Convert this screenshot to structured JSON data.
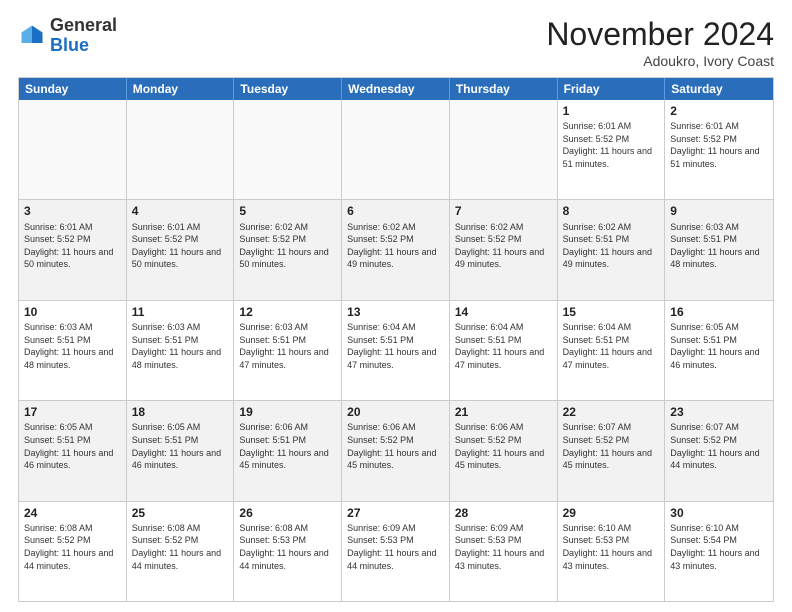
{
  "logo": {
    "line1": "General",
    "line2": "Blue"
  },
  "title": "November 2024",
  "location": "Adoukro, Ivory Coast",
  "header": {
    "days": [
      "Sunday",
      "Monday",
      "Tuesday",
      "Wednesday",
      "Thursday",
      "Friday",
      "Saturday"
    ]
  },
  "weeks": [
    {
      "cells": [
        {
          "day": "",
          "empty": true
        },
        {
          "day": "",
          "empty": true
        },
        {
          "day": "",
          "empty": true
        },
        {
          "day": "",
          "empty": true
        },
        {
          "day": "",
          "empty": true
        },
        {
          "day": "1",
          "sunrise": "6:01 AM",
          "sunset": "5:52 PM",
          "daylight": "11 hours and 51 minutes."
        },
        {
          "day": "2",
          "sunrise": "6:01 AM",
          "sunset": "5:52 PM",
          "daylight": "11 hours and 51 minutes."
        }
      ]
    },
    {
      "cells": [
        {
          "day": "3",
          "sunrise": "6:01 AM",
          "sunset": "5:52 PM",
          "daylight": "11 hours and 50 minutes."
        },
        {
          "day": "4",
          "sunrise": "6:01 AM",
          "sunset": "5:52 PM",
          "daylight": "11 hours and 50 minutes."
        },
        {
          "day": "5",
          "sunrise": "6:02 AM",
          "sunset": "5:52 PM",
          "daylight": "11 hours and 50 minutes."
        },
        {
          "day": "6",
          "sunrise": "6:02 AM",
          "sunset": "5:52 PM",
          "daylight": "11 hours and 49 minutes."
        },
        {
          "day": "7",
          "sunrise": "6:02 AM",
          "sunset": "5:52 PM",
          "daylight": "11 hours and 49 minutes."
        },
        {
          "day": "8",
          "sunrise": "6:02 AM",
          "sunset": "5:51 PM",
          "daylight": "11 hours and 49 minutes."
        },
        {
          "day": "9",
          "sunrise": "6:03 AM",
          "sunset": "5:51 PM",
          "daylight": "11 hours and 48 minutes."
        }
      ]
    },
    {
      "cells": [
        {
          "day": "10",
          "sunrise": "6:03 AM",
          "sunset": "5:51 PM",
          "daylight": "11 hours and 48 minutes."
        },
        {
          "day": "11",
          "sunrise": "6:03 AM",
          "sunset": "5:51 PM",
          "daylight": "11 hours and 48 minutes."
        },
        {
          "day": "12",
          "sunrise": "6:03 AM",
          "sunset": "5:51 PM",
          "daylight": "11 hours and 47 minutes."
        },
        {
          "day": "13",
          "sunrise": "6:04 AM",
          "sunset": "5:51 PM",
          "daylight": "11 hours and 47 minutes."
        },
        {
          "day": "14",
          "sunrise": "6:04 AM",
          "sunset": "5:51 PM",
          "daylight": "11 hours and 47 minutes."
        },
        {
          "day": "15",
          "sunrise": "6:04 AM",
          "sunset": "5:51 PM",
          "daylight": "11 hours and 47 minutes."
        },
        {
          "day": "16",
          "sunrise": "6:05 AM",
          "sunset": "5:51 PM",
          "daylight": "11 hours and 46 minutes."
        }
      ]
    },
    {
      "cells": [
        {
          "day": "17",
          "sunrise": "6:05 AM",
          "sunset": "5:51 PM",
          "daylight": "11 hours and 46 minutes."
        },
        {
          "day": "18",
          "sunrise": "6:05 AM",
          "sunset": "5:51 PM",
          "daylight": "11 hours and 46 minutes."
        },
        {
          "day": "19",
          "sunrise": "6:06 AM",
          "sunset": "5:51 PM",
          "daylight": "11 hours and 45 minutes."
        },
        {
          "day": "20",
          "sunrise": "6:06 AM",
          "sunset": "5:52 PM",
          "daylight": "11 hours and 45 minutes."
        },
        {
          "day": "21",
          "sunrise": "6:06 AM",
          "sunset": "5:52 PM",
          "daylight": "11 hours and 45 minutes."
        },
        {
          "day": "22",
          "sunrise": "6:07 AM",
          "sunset": "5:52 PM",
          "daylight": "11 hours and 45 minutes."
        },
        {
          "day": "23",
          "sunrise": "6:07 AM",
          "sunset": "5:52 PM",
          "daylight": "11 hours and 44 minutes."
        }
      ]
    },
    {
      "cells": [
        {
          "day": "24",
          "sunrise": "6:08 AM",
          "sunset": "5:52 PM",
          "daylight": "11 hours and 44 minutes."
        },
        {
          "day": "25",
          "sunrise": "6:08 AM",
          "sunset": "5:52 PM",
          "daylight": "11 hours and 44 minutes."
        },
        {
          "day": "26",
          "sunrise": "6:08 AM",
          "sunset": "5:53 PM",
          "daylight": "11 hours and 44 minutes."
        },
        {
          "day": "27",
          "sunrise": "6:09 AM",
          "sunset": "5:53 PM",
          "daylight": "11 hours and 44 minutes."
        },
        {
          "day": "28",
          "sunrise": "6:09 AM",
          "sunset": "5:53 PM",
          "daylight": "11 hours and 43 minutes."
        },
        {
          "day": "29",
          "sunrise": "6:10 AM",
          "sunset": "5:53 PM",
          "daylight": "11 hours and 43 minutes."
        },
        {
          "day": "30",
          "sunrise": "6:10 AM",
          "sunset": "5:54 PM",
          "daylight": "11 hours and 43 minutes."
        }
      ]
    }
  ]
}
